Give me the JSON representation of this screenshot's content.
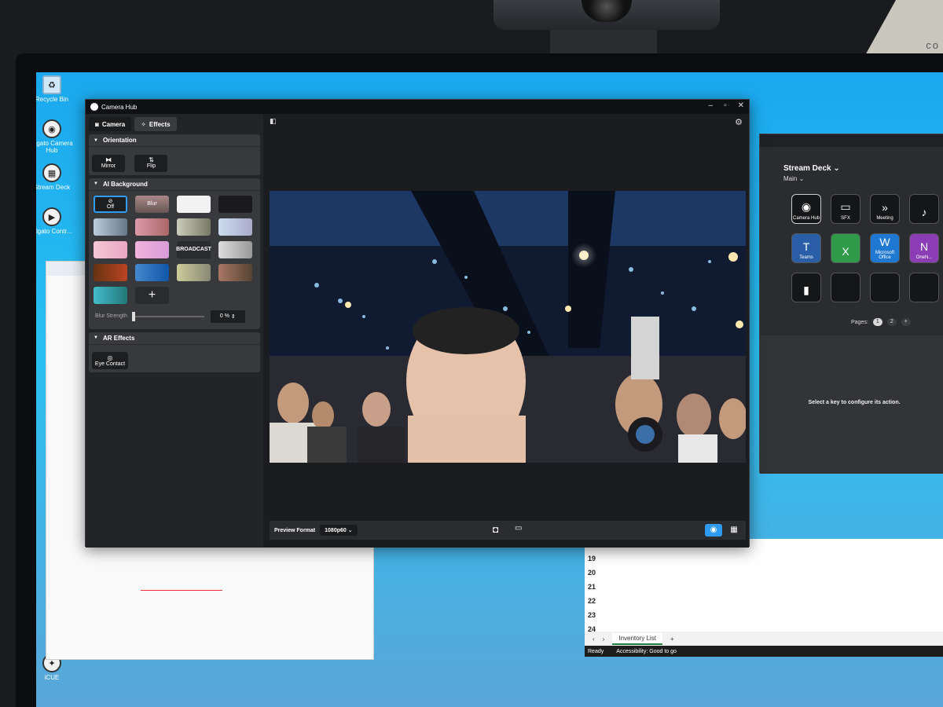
{
  "desktop": {
    "icons": [
      {
        "label": "Recycle Bin",
        "icon": "recycle-bin-icon"
      },
      {
        "label": "Elgato Camera Hub",
        "icon": "camera-hub-icon"
      },
      {
        "label": "Stream Deck",
        "icon": "stream-deck-icon"
      },
      {
        "label": "Elgato Contr...",
        "icon": "elgato-control-icon"
      },
      {
        "label": "iCUE",
        "icon": "icue-icon"
      }
    ],
    "brand_corner": "co"
  },
  "camera_hub": {
    "title": "Camera Hub",
    "tabs": [
      {
        "label": "Camera"
      },
      {
        "label": "Effects"
      }
    ],
    "orientation": {
      "heading": "Orientation",
      "mirror": "Mirror",
      "flip": "Flip"
    },
    "ai_background": {
      "heading": "AI Background",
      "off": "Off",
      "blur": "Blur",
      "broadcast": "BROADCAST",
      "blur_strength_label": "Blur Strength",
      "blur_strength_value": "0 %"
    },
    "ar_effects": {
      "heading": "AR Effects",
      "eye_contact": "Eye Contact"
    },
    "preview_format_label": "Preview Format",
    "preview_format_value": "1080p60"
  },
  "stream_deck": {
    "title": "Stream Deck",
    "profile": "Main",
    "keys": [
      "Camera Hub",
      "SFX",
      "Meeting",
      "",
      "Teams",
      "",
      "Microsoft Office",
      "OneN..."
    ],
    "pages_label": "Pages:",
    "pages": [
      "1",
      "2",
      "+"
    ],
    "hint": "Select a key to configure its action."
  },
  "spreadsheet": {
    "row_numbers": [
      "18",
      "19",
      "20",
      "21",
      "22",
      "23",
      "24"
    ],
    "sheet_tab": "Inventory List",
    "status_ready": "Ready",
    "status_access": "Accessibility: Good to go"
  },
  "colors": {
    "accent": "#2f9cf1",
    "desktop": "#1aa8ee",
    "panel": "#38393d"
  }
}
